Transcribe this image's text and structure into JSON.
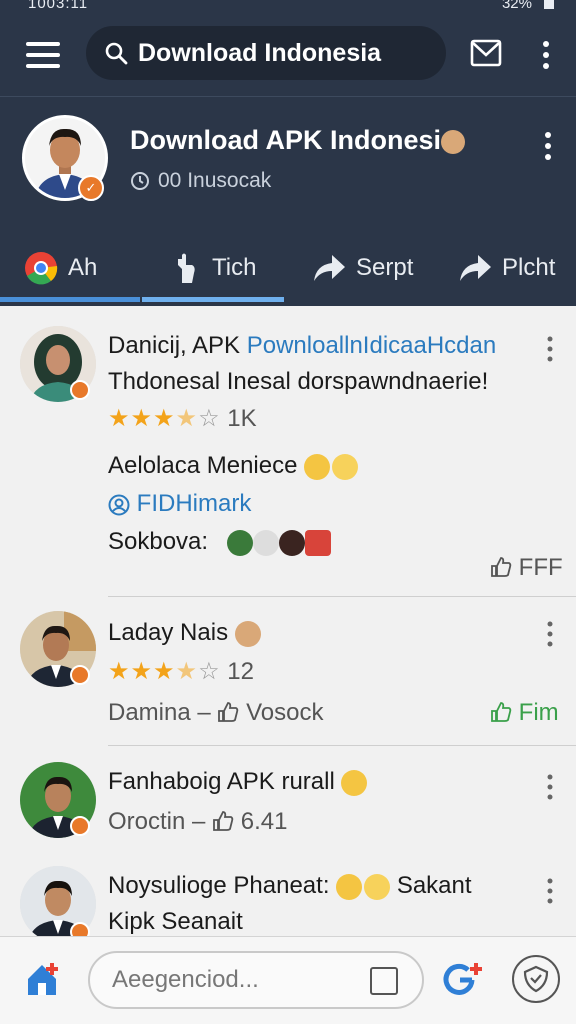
{
  "status_bar": {
    "left": "1003:11",
    "right": "32%"
  },
  "search": {
    "query": "Download Indonesia"
  },
  "profile": {
    "title": "Download APK Indonesi",
    "subtitle": "00 Inusocak"
  },
  "tabs": [
    {
      "label": "Ah"
    },
    {
      "label": "Tich"
    },
    {
      "label": "Serpt"
    },
    {
      "label": "Plcht"
    }
  ],
  "posts": [
    {
      "name": "Danicij, APK",
      "link": "PownloallnIdicaaHcdan",
      "text": "Thdonesal Inesal dorspawndnaerie!",
      "rating": 3.5,
      "count": "1K",
      "line2": "Aelolaca Meniece",
      "tag": "FIDHimark",
      "reactions_label": "Sokbova:",
      "like_label": "FFF"
    },
    {
      "name": "Laday Nais",
      "rating": 3.5,
      "count": "12",
      "meta_left": "Damina",
      "meta_like": "Vosock",
      "action": "Fim"
    },
    {
      "name": "Fanhaboig APK rurall",
      "meta_left": "Oroctin",
      "meta_like": "6.41"
    },
    {
      "name": "Noysulioge Phaneat:",
      "name_suffix": "Sakant",
      "line2": "Kipk Seanait"
    }
  ],
  "bottom_bar": {
    "compose_placeholder": "Aeegenciod..."
  },
  "colors": {
    "header_bg": "#2b3648",
    "accent_blue": "#2b7bbf",
    "star": "#f3a31a",
    "badge_orange": "#e8792a",
    "green": "#3aa04a"
  },
  "icons": [
    "menu-icon",
    "search-icon",
    "mail-icon",
    "more-vert-icon",
    "chrome-icon",
    "hand-icon",
    "share-icon",
    "forward-icon",
    "thumbs-up-icon",
    "home-icon",
    "google-plus-icon",
    "shield-icon"
  ]
}
